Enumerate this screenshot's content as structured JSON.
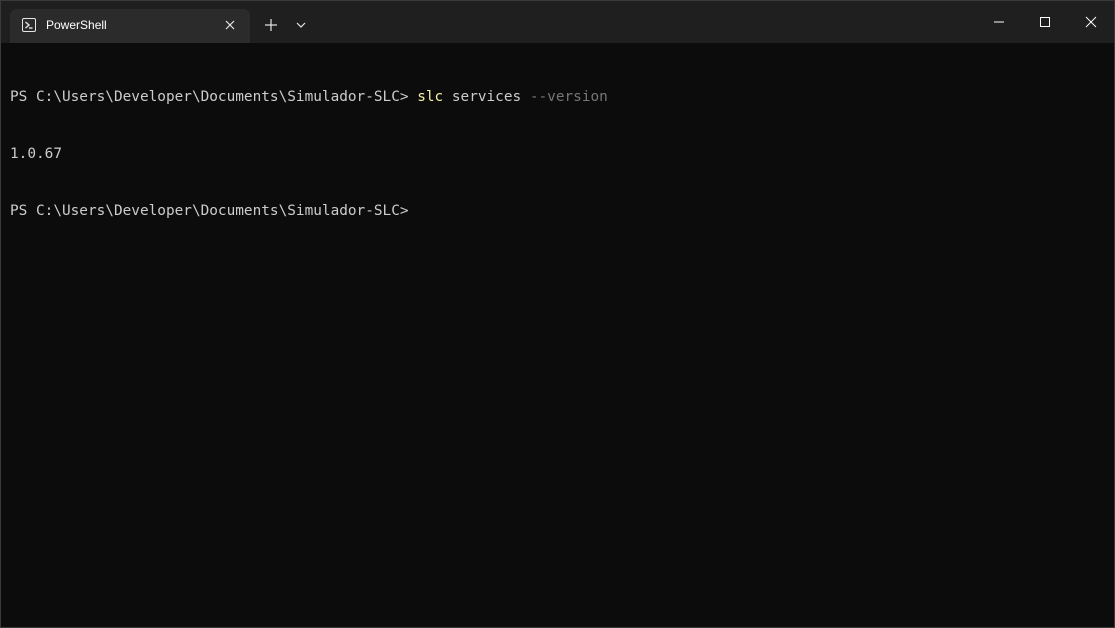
{
  "tab": {
    "title": "PowerShell",
    "icon": "powershell-icon"
  },
  "titlebar_buttons": {
    "new_tab_icon": "plus-icon",
    "dropdown_icon": "chevron-down-icon",
    "minimize_icon": "minimize-icon",
    "maximize_icon": "maximize-icon",
    "close_icon": "close-icon"
  },
  "terminal": {
    "line1": {
      "prompt": "PS C:\\Users\\Developer\\Documents\\Simulador-SLC> ",
      "command": "slc",
      "argument": " services ",
      "parameter": "--version"
    },
    "line2": {
      "output": "1.0.67"
    },
    "line3": {
      "prompt": "PS C:\\Users\\Developer\\Documents\\Simulador-SLC>"
    }
  },
  "colors": {
    "background": "#0c0c0c",
    "titlebar": "#1f1f1f",
    "tab_active": "#2b2b2b",
    "text": "#cccccc",
    "command": "#f9f1a5",
    "parameter": "#767676"
  }
}
